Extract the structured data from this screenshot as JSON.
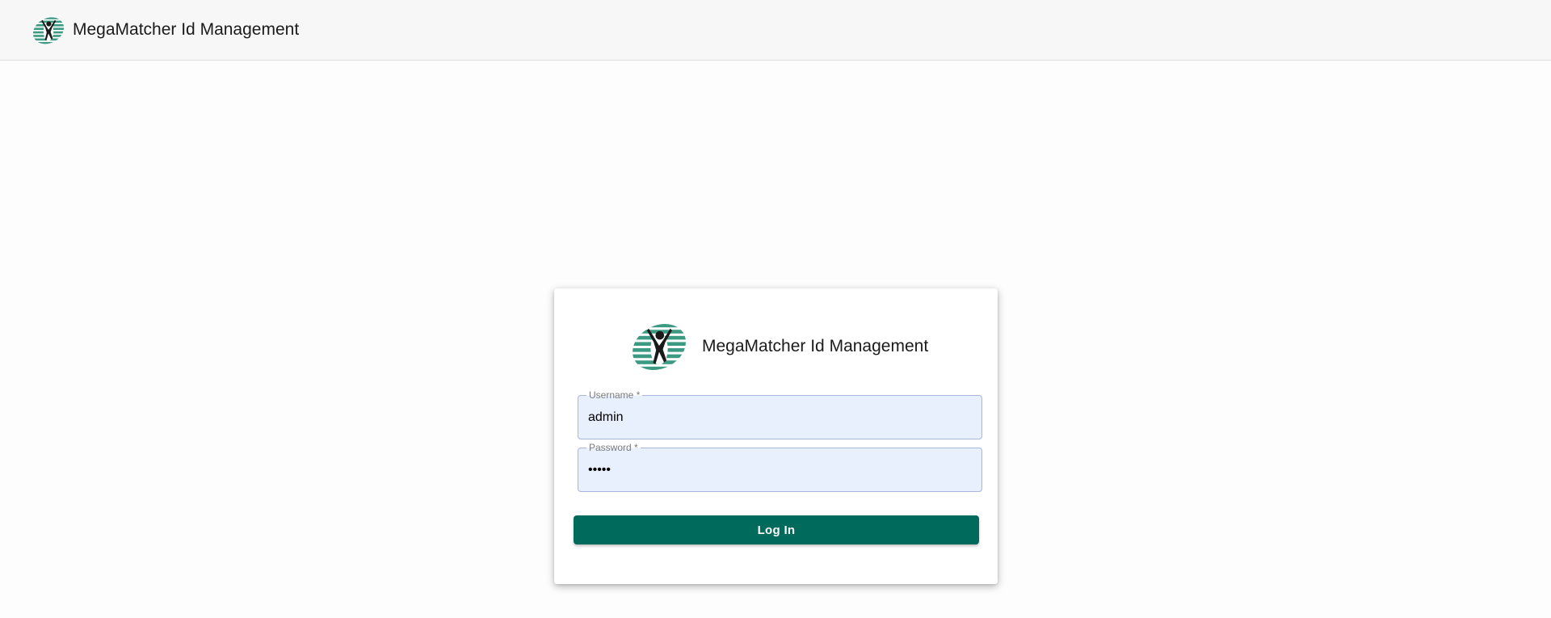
{
  "app": {
    "title": "MegaMatcher Id Management",
    "logo_icon": "megamatcher-logo-icon"
  },
  "login": {
    "title": "MegaMatcher Id Management",
    "username": {
      "label": "Username *",
      "value": "admin"
    },
    "password": {
      "label": "Password *",
      "value": "•••••"
    },
    "submit_label": "Log In"
  },
  "colors": {
    "brand": "#006b5d",
    "logo_green": "#3d9a82",
    "autofill_bg": "#e8effd"
  }
}
